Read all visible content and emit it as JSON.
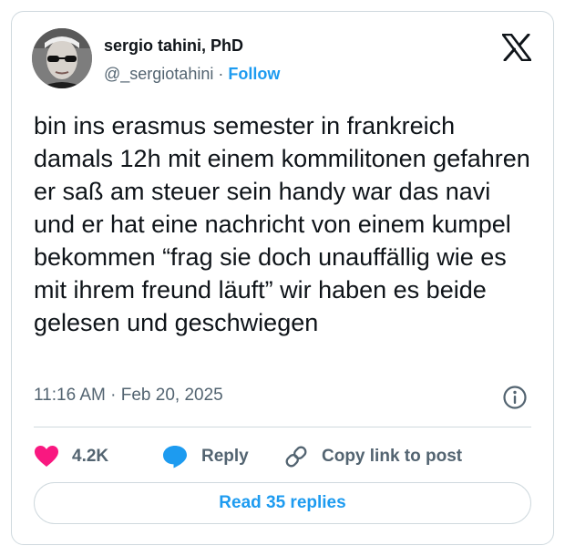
{
  "author": {
    "display_name": "sergio tahini, PhD",
    "handle": "@_sergiotahini",
    "separator": " · ",
    "follow_label": "Follow"
  },
  "tweet": {
    "text": "bin ins erasmus semester in frankreich damals 12h mit einem kommilitonen gefahren er saß am steuer sein handy war das navi und er hat eine nachricht von einem kumpel bekommen “frag sie doch unauffällig wie es mit ihrem freund läuft” wir haben es beide gelesen und geschwiegen",
    "timestamp": "11:16 AM · Feb 20, 2025"
  },
  "actions": {
    "likes_count": "4.2K",
    "reply_label": "Reply",
    "copy_link_label": "Copy link to post"
  },
  "footer": {
    "read_replies_label": "Read 35 replies"
  },
  "icons": {
    "brand": "x-logo-icon",
    "like": "heart-icon",
    "reply": "speech-bubble-icon",
    "copy": "link-icon",
    "info": "info-icon"
  },
  "colors": {
    "accent": "#1d9bf0",
    "like": "#f91880",
    "text": "#0f1419",
    "muted": "#536471",
    "border": "#cfd9de"
  }
}
